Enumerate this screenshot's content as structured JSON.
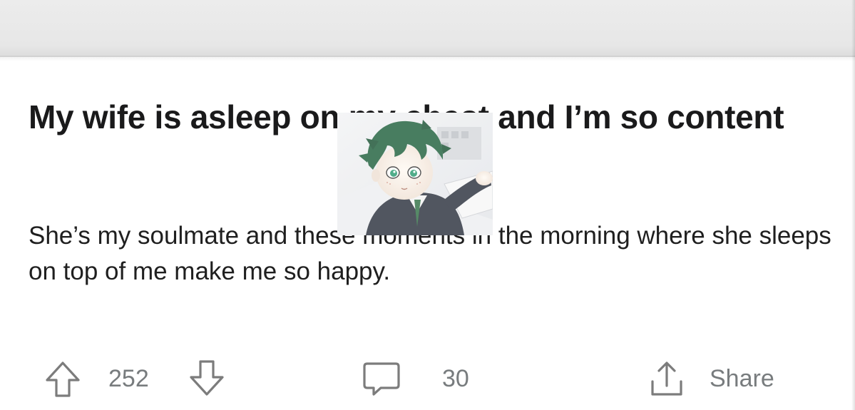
{
  "post": {
    "title": "My wife is asleep on my chest and I’m so content",
    "body": "She’s my soulmate and these moments in the morning where she sleeps on top of me make me so happy."
  },
  "actions": {
    "vote_count": "252",
    "comment_count": "30",
    "share_label": "Share"
  },
  "icons": {
    "upvote": "arrow-up-outline-icon",
    "downvote": "arrow-down-outline-icon",
    "comment": "speech-bubble-icon",
    "share": "share-tray-icon"
  },
  "colors": {
    "title_text": "#1a1a1b",
    "body_text": "#1f1f1f",
    "action_gray": "#787c7e",
    "top_band": "#e8e8e8"
  },
  "overlay": {
    "description": "green-haired anime character portrait"
  }
}
